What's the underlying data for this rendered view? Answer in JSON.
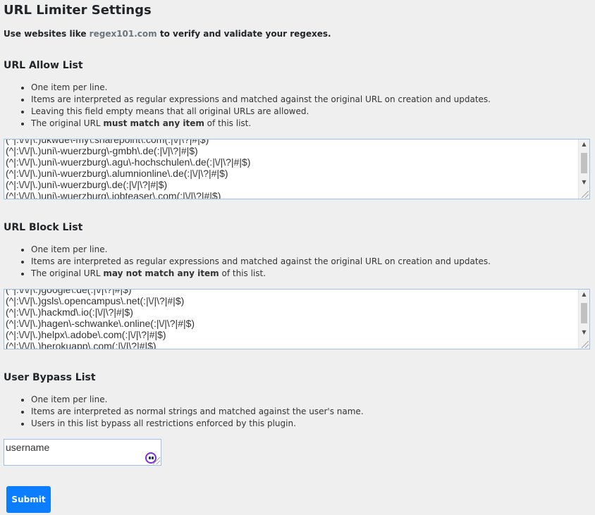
{
  "header": {
    "title": "URL Limiter Settings"
  },
  "intro": {
    "prefix": "Use websites like ",
    "link": "regex101.com",
    "suffix": " to verify and validate your regexes."
  },
  "allow": {
    "heading": "URL Allow List",
    "rules": [
      [
        "One item per line.",
        "",
        ""
      ],
      [
        "Items are interpreted as regular expressions and matched against the original URL on creation and updates.",
        "",
        ""
      ],
      [
        "Leaving this field empty means that all original URLs are allowed.",
        "",
        ""
      ],
      [
        "The original URL ",
        "must match any item",
        " of this list."
      ]
    ],
    "lines": [
      "(^|:\\/\\/|\\.)ukwde\\-my\\.sharepoint\\.com(:|\\/|\\?|#|$)",
      "(^|:\\/\\/|\\.)uni\\-wuerzburg\\-gmbh\\.de(:|\\/|\\?|#|$)",
      "(^|:\\/\\/|\\.)uni\\-wuerzburg\\.agu\\-hochschulen\\.de(:|\\/|\\?|#|$)",
      "(^|:\\/\\/|\\.)uni\\-wuerzburg\\.alumnionline\\.de(:|\\/|\\?|#|$)",
      "(^|:\\/\\/|\\.)uni\\-wuerzburg\\.de(:|\\/|\\?|#|$)",
      "(^|:\\/\\/|\\.)uni\\-wuerzburg\\.jobteaser\\.com(:|\\/|\\?|#|$)"
    ]
  },
  "block": {
    "heading": "URL Block List",
    "rules": [
      [
        "One item per line.",
        "",
        ""
      ],
      [
        "Items are interpreted as regular expressions and matched against the original URL on creation and updates.",
        "",
        ""
      ],
      [
        "The original URL ",
        "may not match any item",
        " of this list."
      ]
    ],
    "lines": [
      "(^|:\\/\\/|\\.)google\\.de(:|\\/|\\?|#|$)",
      "(^|:\\/\\/|\\.)gsls\\.opencampus\\.net(:|\\/|\\?|#|$)",
      "(^|:\\/\\/|\\.)hackmd\\.io(:|\\/|\\?|#|$)",
      "(^|:\\/\\/|\\.)hagen\\-schwanke\\.online(:|\\/|\\?|#|$)",
      "(^|:\\/\\/|\\.)helpx\\.adobe\\.com(:|\\/|\\?|#|$)",
      "(^|:\\/\\/|\\.)herokuapp\\.com(:|\\/|\\?|#|$)"
    ]
  },
  "bypass": {
    "heading": "User Bypass List",
    "rules": [
      [
        "One item per line.",
        "",
        ""
      ],
      [
        "Items are interpreted as normal strings and matched against the user's name.",
        "",
        ""
      ],
      [
        "Users in this list bypass all restrictions enforced by this plugin.",
        "",
        ""
      ]
    ],
    "value": "username",
    "icon": "password-manager-icon"
  },
  "submit": {
    "label": "Submit"
  },
  "colors": {
    "accent": "#0b7dfe",
    "link": "#6c757d",
    "border": "#9cc0ea",
    "background": "#efefef"
  }
}
